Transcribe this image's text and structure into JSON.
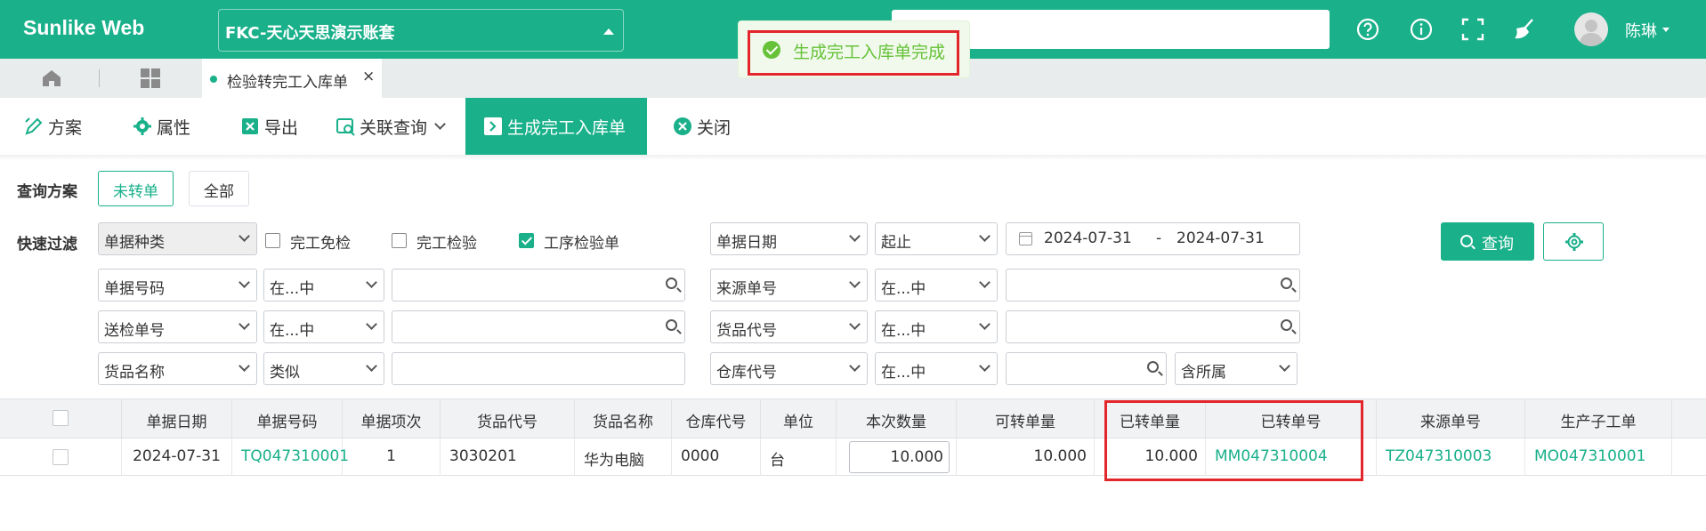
{
  "header": {
    "brand": "Sunlike Web",
    "company": "FKC-天心天思演示账套",
    "user_name": "陈琳",
    "icons": [
      "help-icon",
      "info-icon",
      "fullscreen-icon",
      "clean-icon"
    ]
  },
  "toast": {
    "message": "生成完工入库单完成",
    "type": "success"
  },
  "tabs": {
    "active_label": "检验转完工入库单",
    "close_glyph": "×"
  },
  "toolbar": {
    "scheme": "方案",
    "properties": "属性",
    "export": "导出",
    "related_query": "关联查询",
    "generate": "生成完工入库单",
    "close": "关闭"
  },
  "filters": {
    "scheme_label": "查询方案",
    "scheme_options": [
      "未转单",
      "全部"
    ],
    "scheme_selected": "未转单",
    "quick_label": "快速过滤",
    "doc_type": "单据种类",
    "checkboxes": [
      {
        "label": "完工免检",
        "checked": false
      },
      {
        "label": "完工检验",
        "checked": false
      },
      {
        "label": "工序检验单",
        "checked": true
      }
    ],
    "date_field": "单据日期",
    "date_op": "起止",
    "date_from": "2024-07-31",
    "date_sep": "-",
    "date_to": "2024-07-31",
    "rows": [
      {
        "field": "单据号码",
        "op": "在...中",
        "field2": "来源单号",
        "op2": "在...中"
      },
      {
        "field": "送检单号",
        "op": "在...中",
        "field2": "货品代号",
        "op2": "在...中"
      },
      {
        "field": "货品名称",
        "op": "类似",
        "field2": "仓库代号",
        "op2": "在...中",
        "extra": "含所属"
      }
    ],
    "query_button": "查询"
  },
  "grid": {
    "columns": [
      "单据日期",
      "单据号码",
      "单据项次",
      "货品代号",
      "货品名称",
      "仓库代号",
      "单位",
      "本次数量",
      "可转单量",
      "已转单量",
      "已转单号",
      "来源单号",
      "生产子工单"
    ],
    "rows": [
      {
        "date": "2024-07-31",
        "doc_no": "TQ047310001",
        "item_seq": "1",
        "product_code": "3030201",
        "product_name": "华为电脑",
        "warehouse": "0000",
        "unit": "台",
        "qty": "10.000",
        "available": "10.000",
        "converted_qty": "10.000",
        "converted_no": "MM047310004",
        "source_no": "TZ047310003",
        "sub_order": "MO047310001"
      }
    ]
  },
  "colors": {
    "brand": "#19b08a",
    "success": "#67c23a",
    "highlight": "#e3262b"
  }
}
